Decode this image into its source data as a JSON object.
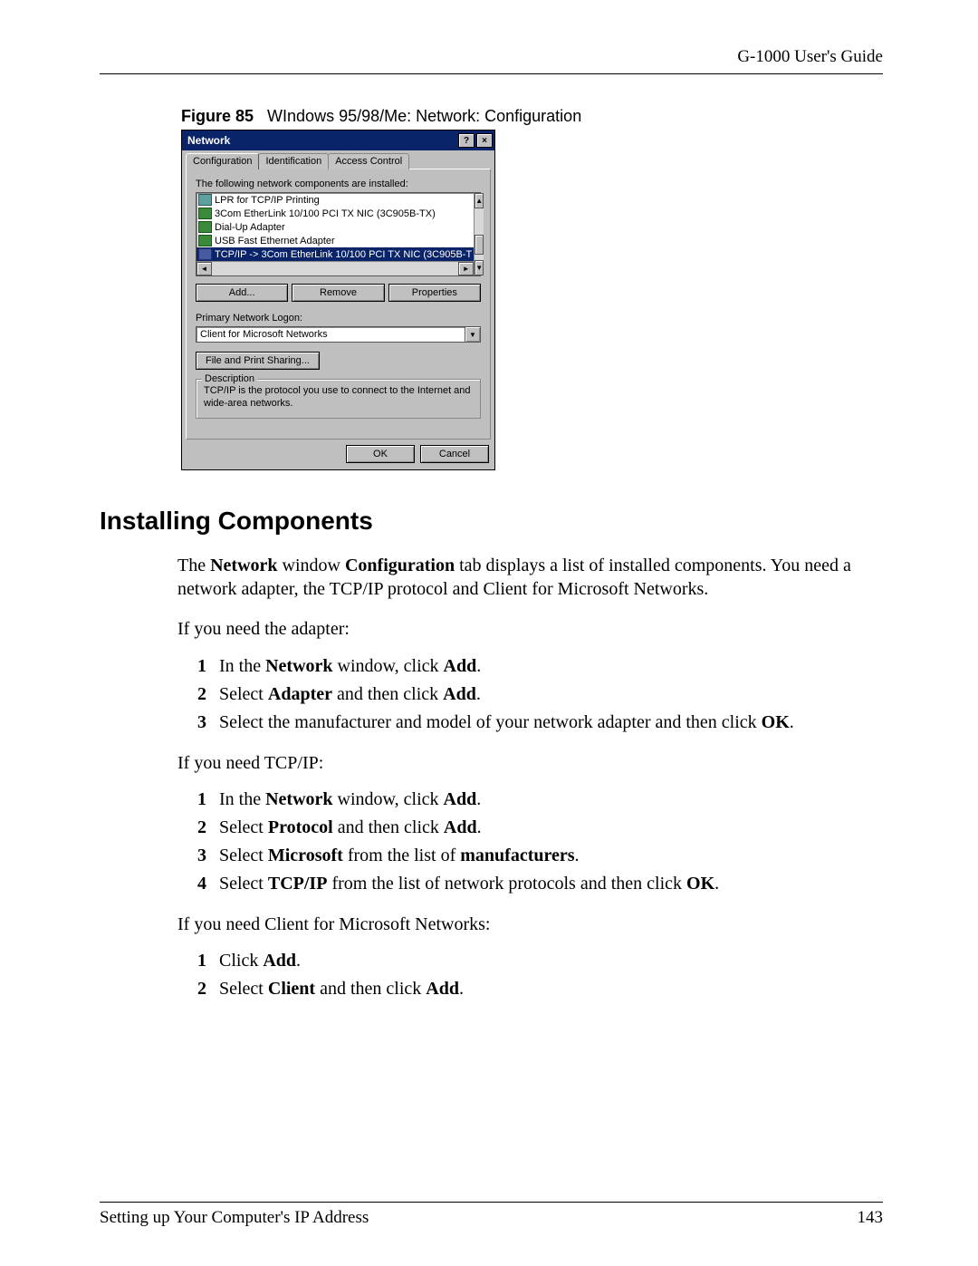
{
  "header": {
    "guide_title": "G-1000 User's Guide"
  },
  "figure": {
    "label": "Figure 85",
    "caption": "WIndows 95/98/Me: Network: Configuration"
  },
  "dialog": {
    "title": "Network",
    "help_btn": "?",
    "close_btn": "×",
    "tabs": [
      "Configuration",
      "Identification",
      "Access Control"
    ],
    "components_label": "The following network components are installed:",
    "components_label_u": "n",
    "list_items": [
      "LPR for TCP/IP Printing",
      "3Com EtherLink 10/100 PCI TX NIC (3C905B-TX)",
      "Dial-Up Adapter",
      "USB Fast Ethernet Adapter",
      "TCP/IP -> 3Com EtherLink 10/100 PCI TX NIC (3C905B-T"
    ],
    "buttons": {
      "add": "Add...",
      "remove": "Remove",
      "properties": "Properties"
    },
    "logon_label": "Primary Network Logon:",
    "logon_value": "Client for Microsoft Networks",
    "fps_button": "File and Print Sharing...",
    "desc_legend": "Description",
    "desc_text": "TCP/IP is the protocol you use to connect to the Internet and wide-area networks.",
    "ok": "OK",
    "cancel": "Cancel"
  },
  "section_heading": "Installing Components",
  "para_intro_pre": "The ",
  "para_intro_b1": "Network",
  "para_intro_mid1": " window ",
  "para_intro_b2": "Configuration",
  "para_intro_post": " tab displays a list of installed components. You need a network adapter, the TCP/IP protocol and Client for Microsoft Networks.",
  "adapter_lead": "If you need the adapter:",
  "adapter_steps": [
    {
      "pre": "In the ",
      "b1": "Network",
      "mid": " window, click ",
      "b2": "Add",
      "post": "."
    },
    {
      "pre": "Select ",
      "b1": "Adapter",
      "mid": " and then click ",
      "b2": "Add",
      "post": "."
    },
    {
      "pre": "Select the manufacturer and model of your network adapter and then click ",
      "b1": "OK",
      "mid": "",
      "b2": "",
      "post": "."
    }
  ],
  "tcpip_lead": "If you need TCP/IP:",
  "tcpip_steps": [
    {
      "pre": "In the ",
      "b1": "Network",
      "mid": " window, click ",
      "b2": "Add",
      "post": "."
    },
    {
      "pre": "Select ",
      "b1": "Protocol",
      "mid": " and then click ",
      "b2": "Add",
      "post": "."
    },
    {
      "pre": "Select ",
      "b1": "Microsoft",
      "mid": " from the list of ",
      "b2": "manufacturers",
      "post": "."
    },
    {
      "pre": "Select ",
      "b1": "TCP/IP",
      "mid": " from the list of network protocols and then click ",
      "b2": "OK",
      "post": "."
    }
  ],
  "client_lead": "If you need Client for Microsoft Networks:",
  "client_steps": [
    {
      "pre": "Click ",
      "b1": "Add",
      "mid": "",
      "b2": "",
      "post": "."
    },
    {
      "pre": "Select ",
      "b1": "Client",
      "mid": " and then click ",
      "b2": "Add",
      "post": "."
    }
  ],
  "footer": {
    "chapter": "Setting up Your Computer's IP Address",
    "page_num": "143"
  }
}
